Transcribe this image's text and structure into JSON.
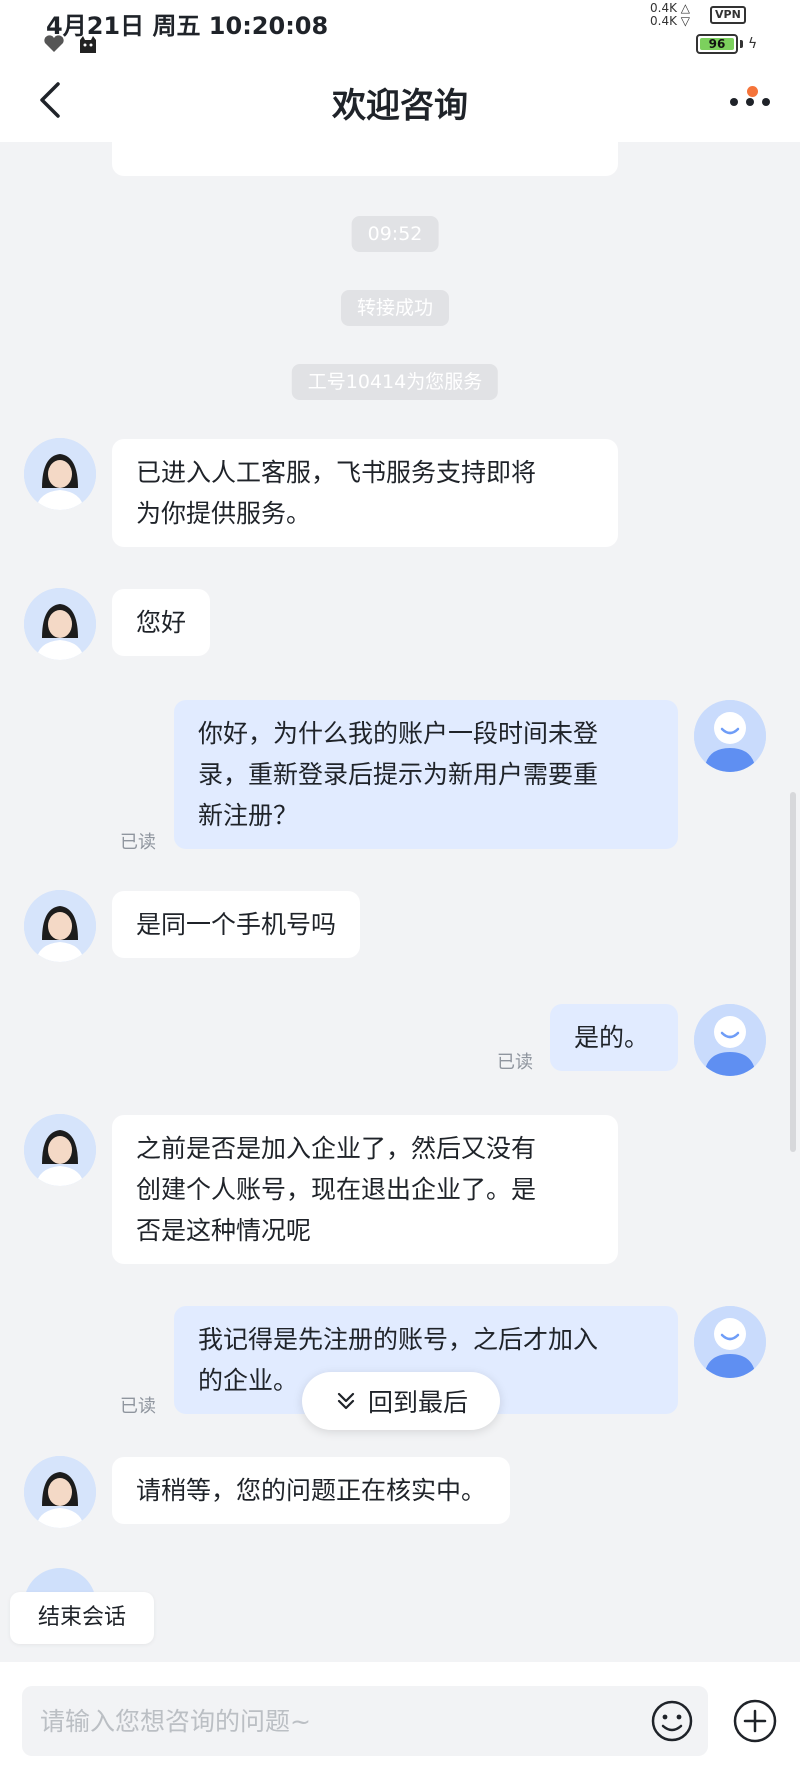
{
  "status_bar": {
    "datetime": "4月21日 周五 10:20:08",
    "net_up": "0.4K",
    "net_down": "0.4K",
    "vpn": "VPN",
    "battery": "96"
  },
  "header": {
    "title": "欢迎咨询"
  },
  "chat": {
    "timestamp": "09:52",
    "system_transfer": "转接成功",
    "system_agent_id": "工号10414为您服务",
    "messages": [
      {
        "from": "agent",
        "text_lines": [
          "已进入人工客服，飞书服务支持即将",
          "为你提供服务。"
        ]
      },
      {
        "from": "agent",
        "text_lines": [
          "您好"
        ]
      },
      {
        "from": "user",
        "text_lines": [
          "你好，为什么我的账户一段时间未登",
          "录，重新登录后提示为新用户需要重",
          "新注册？"
        ],
        "status": "已读"
      },
      {
        "from": "agent",
        "text_lines": [
          "是同一个手机号吗"
        ]
      },
      {
        "from": "user",
        "text_lines": [
          "是的。"
        ],
        "status": "已读"
      },
      {
        "from": "agent",
        "text_lines": [
          "之前是否是加入企业了，然后又没有",
          "创建个人账号，现在退出企业了。是",
          "否是这种情况呢"
        ]
      },
      {
        "from": "user",
        "text_lines": [
          "我记得是先注册的账号，之后才加入",
          "的企业。"
        ],
        "status": "已读"
      },
      {
        "from": "agent",
        "text_lines": [
          "请稍等，您的问题正在核实中。"
        ]
      }
    ],
    "jump_to_latest": "回到最后",
    "end_session": "结束会话"
  },
  "input": {
    "placeholder": "请输入您想咨询的问题~"
  },
  "colors": {
    "accent": "#3370ff",
    "user_bubble": "#e1ebff",
    "notification_dot": "#f5743a"
  },
  "icons": [
    "back-arrow-icon",
    "more-icon",
    "chevron-double-down-icon",
    "emoji-icon",
    "plus-circle-icon"
  ]
}
